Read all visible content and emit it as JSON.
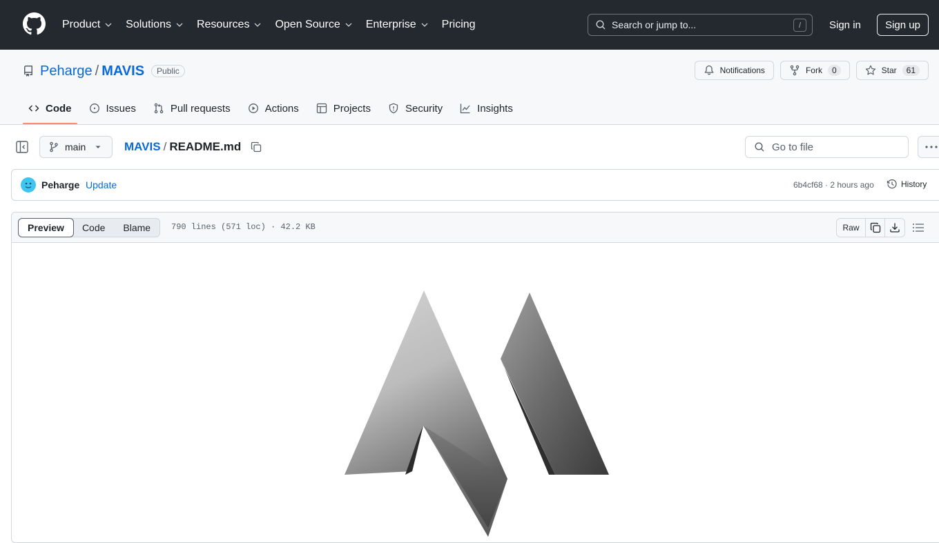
{
  "header": {
    "nav": [
      "Product",
      "Solutions",
      "Resources",
      "Open Source",
      "Enterprise",
      "Pricing"
    ],
    "search_placeholder": "Search or jump to...",
    "search_shortcut": "/",
    "sign_in": "Sign in",
    "sign_up": "Sign up"
  },
  "repo": {
    "owner": "Peharge",
    "separator": "/",
    "name": "MAVIS",
    "visibility": "Public",
    "notifications_label": "Notifications",
    "fork_label": "Fork",
    "fork_count": "0",
    "star_label": "Star",
    "star_count": "61",
    "tabs": [
      "Code",
      "Issues",
      "Pull requests",
      "Actions",
      "Projects",
      "Security",
      "Insights"
    ]
  },
  "filebar": {
    "branch": "main",
    "breadcrumb_repo": "MAVIS",
    "breadcrumb_sep": "/",
    "file_name": "README.md",
    "goto_placeholder": "Go to file"
  },
  "commit": {
    "author": "Peharge",
    "message": "Update",
    "meta": "6b4cf68 · 2 hours ago",
    "history": "History"
  },
  "fileview": {
    "modes": [
      "Preview",
      "Code",
      "Blame"
    ],
    "stats": "790 lines (571 loc) · 42.2 KB",
    "raw": "Raw"
  }
}
